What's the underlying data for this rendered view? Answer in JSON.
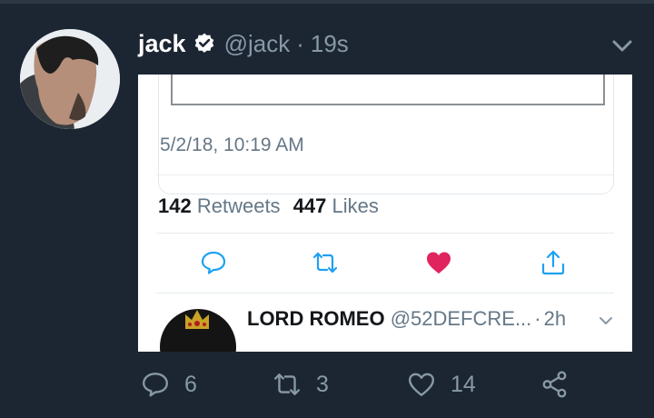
{
  "tweet": {
    "author_name": "jack",
    "author_handle": "@jack",
    "separator": "·",
    "time": "19s"
  },
  "embedded": {
    "timestamp": "5/2/18, 10:19 AM",
    "retweets_count": "142",
    "retweets_label": "Retweets",
    "likes_count": "447",
    "likes_label": "Likes",
    "reply": {
      "name": "LORD ROMEO",
      "handle": "@52DEFCRE...",
      "separator": "·",
      "time": "2h"
    }
  },
  "actions": {
    "replies": "6",
    "retweets": "3",
    "likes": "14"
  },
  "colors": {
    "background": "#1c2633",
    "icon_gray": "#8899a6",
    "like_red": "#e0245e"
  }
}
